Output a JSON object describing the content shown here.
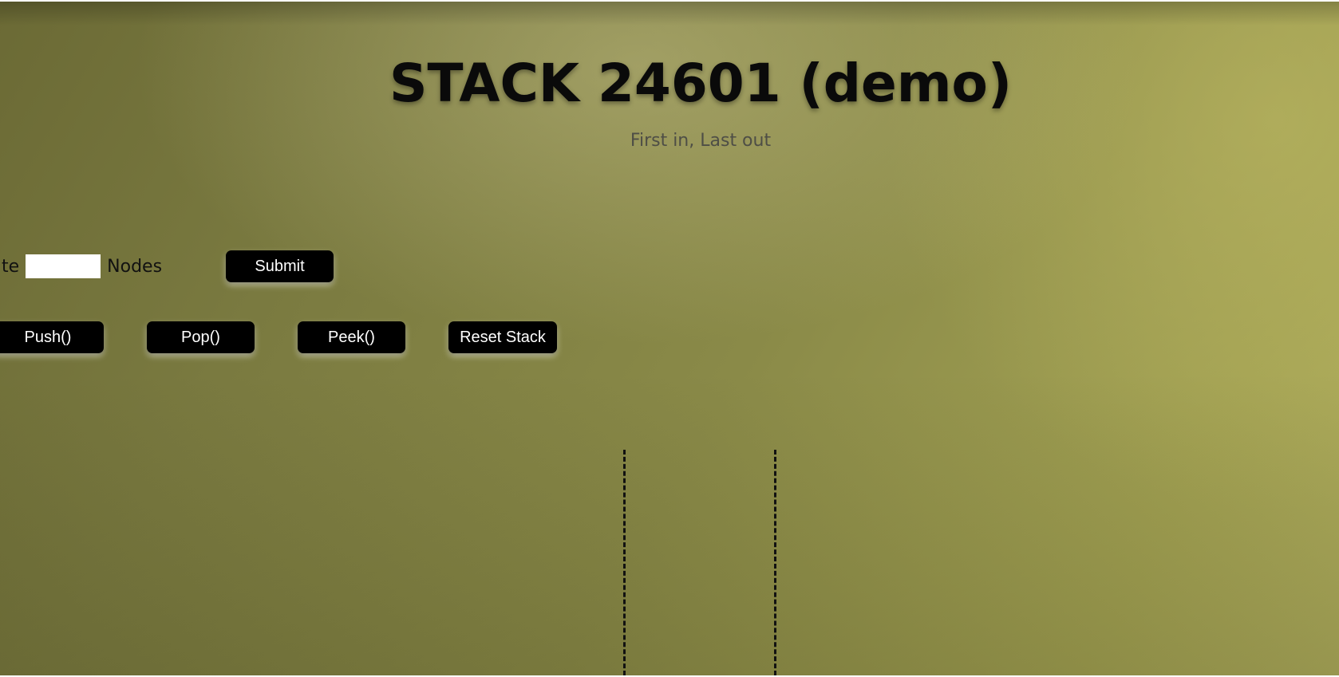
{
  "header": {
    "title": "STACK 24601 (demo)",
    "subtitle": "First in, Last out"
  },
  "generate": {
    "prefix_label": "nerate",
    "input_value": "",
    "suffix_label": "Nodes",
    "submit_label": "Submit"
  },
  "controls": {
    "push_label": "Push()",
    "pop_label": "Pop()",
    "peek_label": "Peek()",
    "reset_label": "Reset Stack"
  },
  "colors": {
    "background_dark": "#6b6a35",
    "background_light": "#b0ae5e",
    "button": "#000000",
    "button_text": "#ffffff",
    "subtitle_text": "#4e4e46"
  }
}
